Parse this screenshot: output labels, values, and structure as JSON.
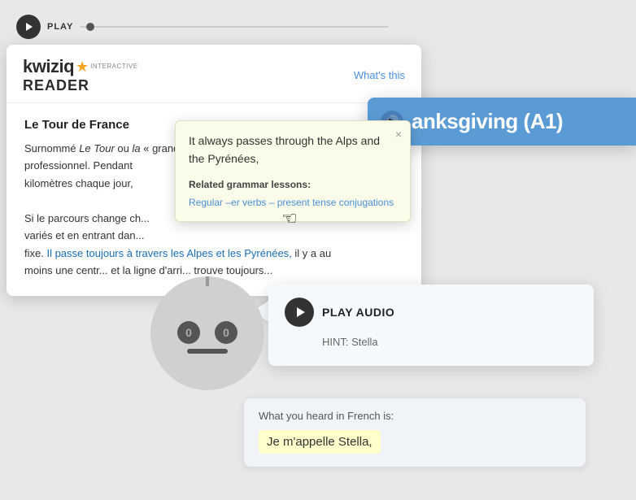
{
  "play_bar": {
    "label": "PLAY"
  },
  "reader": {
    "logo_kwiziq": "kwiziq",
    "logo_star": "★",
    "logo_interactive": "interactive",
    "logo_reader": "READER",
    "whats_this": "What's this",
    "article_title": "Le Tour de France",
    "article_text_1": "Surnommé ",
    "article_text_italic1": "Le Tour",
    "article_text_2": " ou ",
    "article_text_italic2": "la",
    "article_text_3": " « grand tour » le plus an...",
    "article_text_4": "professionnel.  Pendant",
    "article_text_5": "kilomètres chaque jour,",
    "article_text_6": "Si le parcours change ch...",
    "article_text_7": "variés  et en entrant dan...",
    "article_text_8": "fixe.  ",
    "highlighted_sentence": "Il passe toujours à travers les Alpes et les Pyrénées,",
    "article_text_9": "  il y a au",
    "article_text_10": "moins une centr... et la ligne d'arri... trouve toujours..."
  },
  "tooltip": {
    "close": "×",
    "translation": "It always passes through the Alps and the Pyrénées,",
    "related_label": "Related grammar lessons:",
    "link_text": "Regular –er verbs – present tense conjugations"
  },
  "thanksgiving": {
    "icon": "🔊",
    "title": "anksgiving (A1)"
  },
  "audio": {
    "play_label": "PLAY AUDIO",
    "hint": "HINT: Stella"
  },
  "transcript": {
    "label": "What you heard in French is:",
    "value": "Je m'appelle Stella,"
  },
  "robot": {
    "left_eye": "0",
    "right_eye": "0"
  }
}
